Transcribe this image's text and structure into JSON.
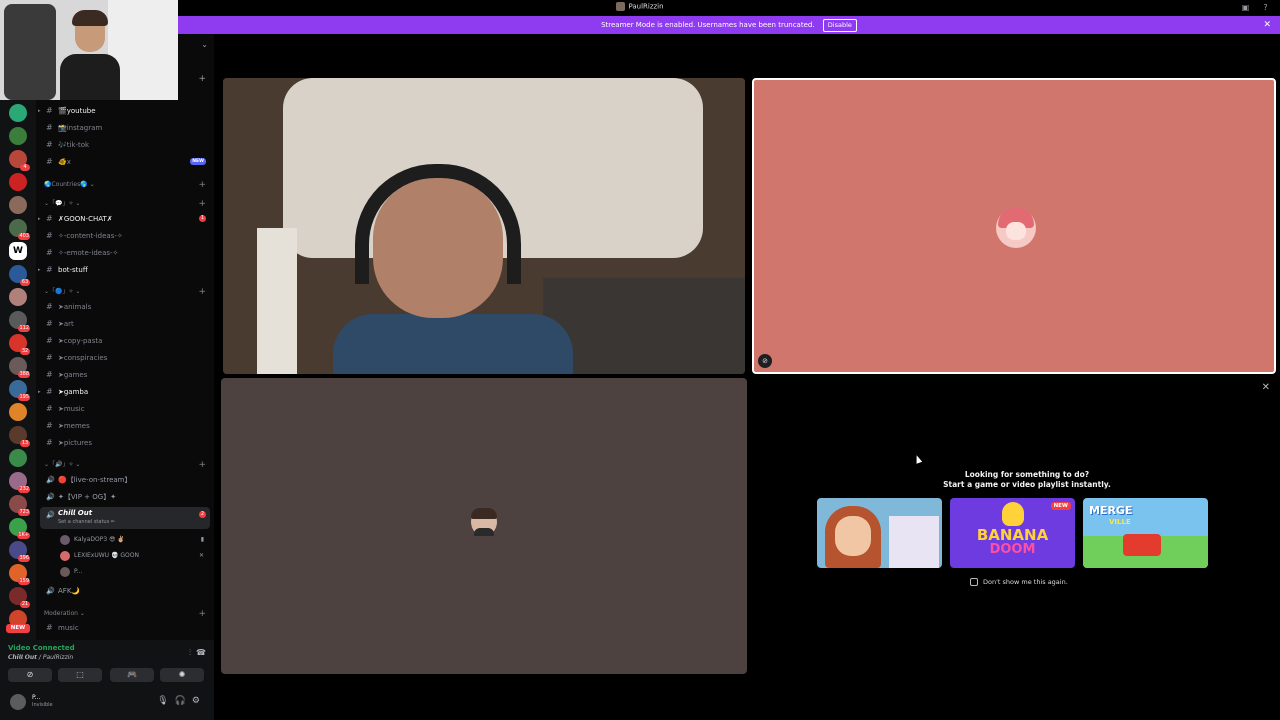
{
  "window": {
    "title": "PaulRizzin"
  },
  "banner": {
    "text": "Streamer Mode is enabled. Usernames have been truncated.",
    "disable_label": "Disable",
    "close_icon": "✕"
  },
  "servers": [
    {
      "color": "#2aa876",
      "badge": ""
    },
    {
      "color": "#3b7d3a",
      "badge": ""
    },
    {
      "color": "#b8473b",
      "badge": "4"
    },
    {
      "color": "#cc2222",
      "badge": ""
    },
    {
      "color": "#8a6a5a",
      "badge": ""
    },
    {
      "color": "#4a6a4a",
      "badge": "403"
    },
    {
      "color": "#ffffff",
      "badge": "",
      "letter": "W"
    },
    {
      "color": "#2a5a9a",
      "badge": "63"
    },
    {
      "color": "#b0807a",
      "badge": ""
    },
    {
      "color": "#5a5a5a",
      "badge": "112"
    },
    {
      "color": "#d8342a",
      "badge": "32"
    },
    {
      "color": "#6a5a5a",
      "badge": "388"
    },
    {
      "color": "#3a6a9a",
      "badge": "195"
    },
    {
      "color": "#e0842a",
      "badge": ""
    },
    {
      "color": "#5a3a2a",
      "badge": "13"
    },
    {
      "color": "#3a8a4a",
      "badge": ""
    },
    {
      "color": "#9a6a8a",
      "badge": "232"
    },
    {
      "color": "#8a4a4a",
      "badge": "723"
    },
    {
      "color": "#3aa04a",
      "badge": "1K+"
    },
    {
      "color": "#4a4a8a",
      "badge": "396"
    },
    {
      "color": "#e0642a",
      "badge": "159"
    },
    {
      "color": "#7a2a2a",
      "badge": "21"
    },
    {
      "color": "#d0442a",
      "badge": "254"
    }
  ],
  "rail_new_label": "NEW",
  "sidebar": {
    "text_channels": [
      {
        "name": "🎬youtube",
        "bright": true
      },
      {
        "name": "📸instagram",
        "bright": false
      },
      {
        "name": "🎶tik-tok",
        "bright": false
      },
      {
        "name": "🐠x",
        "bright": false,
        "new_badge": "NEW"
      }
    ],
    "cat_countries": "🌏Countries🌎 ⌄",
    "cat_chat": "⌄「💬」✧ ⌄",
    "chat_channels": [
      {
        "name": "✗GOON-CHAT✗",
        "bright": true,
        "red_badge": "1"
      },
      {
        "name": "✧-content-ideas-✧",
        "bright": false
      },
      {
        "name": "✧-emote-ideas-✧",
        "bright": false
      },
      {
        "name": "bot-stuff",
        "bright": true
      }
    ],
    "cat_media": "⌄「🔵」✧ ⌄",
    "media_channels": [
      {
        "name": "➤animals",
        "bright": false
      },
      {
        "name": "➤art",
        "bright": false
      },
      {
        "name": "➤copy-pasta",
        "bright": false
      },
      {
        "name": "➤conspiracies",
        "bright": false
      },
      {
        "name": "➤games",
        "bright": false
      },
      {
        "name": "➤gamba",
        "bright": true
      },
      {
        "name": "➤music",
        "bright": false
      },
      {
        "name": "➤memes",
        "bright": false
      },
      {
        "name": "➤pictures",
        "bright": false
      }
    ],
    "cat_voice": "⌄「🔊」✧ ⌄",
    "voice_channels": [
      {
        "name": "🔴【live-on-stream】"
      },
      {
        "name": "✦【VIP + OG】✦"
      }
    ],
    "active_voice": {
      "name": "𝘾𝙝𝙞𝙡𝙡 𝙊𝙪𝙩",
      "sub": "Set a channel status ✏",
      "badge": "2"
    },
    "members": [
      {
        "name": "KalyaDOP3 😎 ✌🏼",
        "color": "#6a5a6a",
        "mic": "▮"
      },
      {
        "name": "LEXIExUWU 💀 GOON",
        "color": "#d86a6a",
        "mic": "✕"
      },
      {
        "name": "P...",
        "color": "#6a5a5a",
        "mic": ""
      }
    ],
    "afk_channel": "AFK🌙",
    "cat_moderation": "Moderation ⌄",
    "moderation_channel": "music"
  },
  "voice_panel": {
    "status": "Video Connected",
    "channel": "𝘾𝙝𝙞𝙡𝙡 𝙊𝙪𝙩 / PaulRizzin",
    "buttons": [
      "⊘",
      "⬚",
      "🎮",
      "✺"
    ]
  },
  "user_panel": {
    "name": "P...",
    "status": "Invisible"
  },
  "activity": {
    "prompt_line1": "Looking for something to do?",
    "prompt_line2": "Start a game or video playlist instantly.",
    "games": [
      {
        "title": ""
      },
      {
        "title_a": "BANANA",
        "title_b": "DOOM",
        "new_tag": "NEW"
      },
      {
        "title_a": "MERGE",
        "title_b": "VILLE"
      }
    ],
    "dont_show": "Don't show me this again."
  }
}
